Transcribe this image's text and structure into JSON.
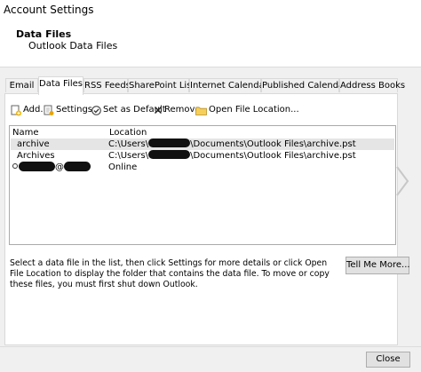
{
  "window": {
    "title": "Account Settings"
  },
  "header": {
    "heading": "Data Files",
    "subheading": "Outlook Data Files"
  },
  "tabs": [
    {
      "label": "Email",
      "active": false
    },
    {
      "label": "Data Files",
      "active": true
    },
    {
      "label": "RSS Feeds",
      "active": false
    },
    {
      "label": "SharePoint Lists",
      "active": false
    },
    {
      "label": "Internet Calendars",
      "active": false
    },
    {
      "label": "Published Calendars",
      "active": false
    },
    {
      "label": "Address Books",
      "active": false
    }
  ],
  "toolbar": {
    "add_label": "Add...",
    "settings_label": "Settings...",
    "set_default_label": "Set as Default",
    "remove_label": "Remove",
    "open_location_label": "Open File Location..."
  },
  "list": {
    "columns": {
      "name": "Name",
      "location": "Location"
    },
    "rows": [
      {
        "name": "archive",
        "location_prefix": "C:\\Users\\",
        "location_suffix": "\\Documents\\Outlook Files\\archive.pst",
        "selected": true
      },
      {
        "name": "Archives",
        "location_prefix": "C:\\Users\\",
        "location_suffix": "\\Documents\\Outlook Files\\archive.pst",
        "selected": false
      },
      {
        "name_at_sign": "@",
        "location": "Online",
        "selected": false
      }
    ]
  },
  "description": "Select a data file in the list, then click Settings for more details or click Open File Location to display the folder that contains the data file. To move or copy these files, you must first shut down Outlook.",
  "buttons": {
    "tell_me_more": "Tell Me More...",
    "close": "Close"
  },
  "icons": {
    "add": "add-file-icon",
    "settings": "settings-file-icon",
    "set_default": "checkmark-icon",
    "remove": "remove-x-icon",
    "open_location": "folder-icon",
    "next": "chevron-right-icon"
  },
  "colors": {
    "selected_row": "#e5e5e5",
    "redaction": "#111111",
    "dialog_background": "#f0f0f0"
  }
}
